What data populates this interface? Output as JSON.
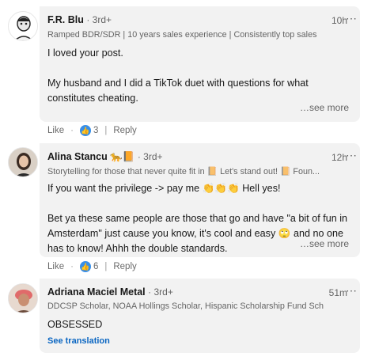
{
  "comments": [
    {
      "author": "F.R. Blu",
      "degree": "· 3rd+",
      "headline": "Ramped BDR/SDR | 10 years sales experience | Consistently top sales",
      "time": "10h",
      "more_icon": "more-dots-icon",
      "lines": [
        "I loved your post.",
        "My husband and I did a TikTok duet with questions for what",
        "constitutes cheating."
      ],
      "see_more": "…see more",
      "like_label": "Like",
      "reaction_count": "3",
      "reply_label": "Reply"
    },
    {
      "author": "Alina Stancu",
      "degree": "· 3rd+",
      "headline": "Storytelling for those that never quite fit in 📙 Let's stand out! 📙 Foun...",
      "time": "12h",
      "more_icon": "more-dots-icon",
      "line1": "If you want the privilege -> pay me 👏👏👏 Hell yes!",
      "line2": "Bet ya these same people are those that go and have \"a bit of fun in",
      "line3": "Amsterdam\" just cause you know, it's cool and easy 🙄 and no one",
      "line4": "has to know! Ahhh the double standards.",
      "see_more": "…see more",
      "like_label": "Like",
      "reaction_count": "6",
      "reply_label": "Reply"
    },
    {
      "author": "Adriana Maciel Metal",
      "degree": "· 3rd+",
      "headline": "DDCSP Scholar, NOAA Hollings Scholar, Hispanic Scholarship Fund Sch...",
      "time": "51m",
      "more_icon": "more-dots-icon",
      "text": "OBSESSED",
      "see_translation": "See translation"
    }
  ],
  "colors": {
    "bubble": "#f2f2f2",
    "link": "#0a66c2",
    "like_reaction": "#378fe9"
  }
}
